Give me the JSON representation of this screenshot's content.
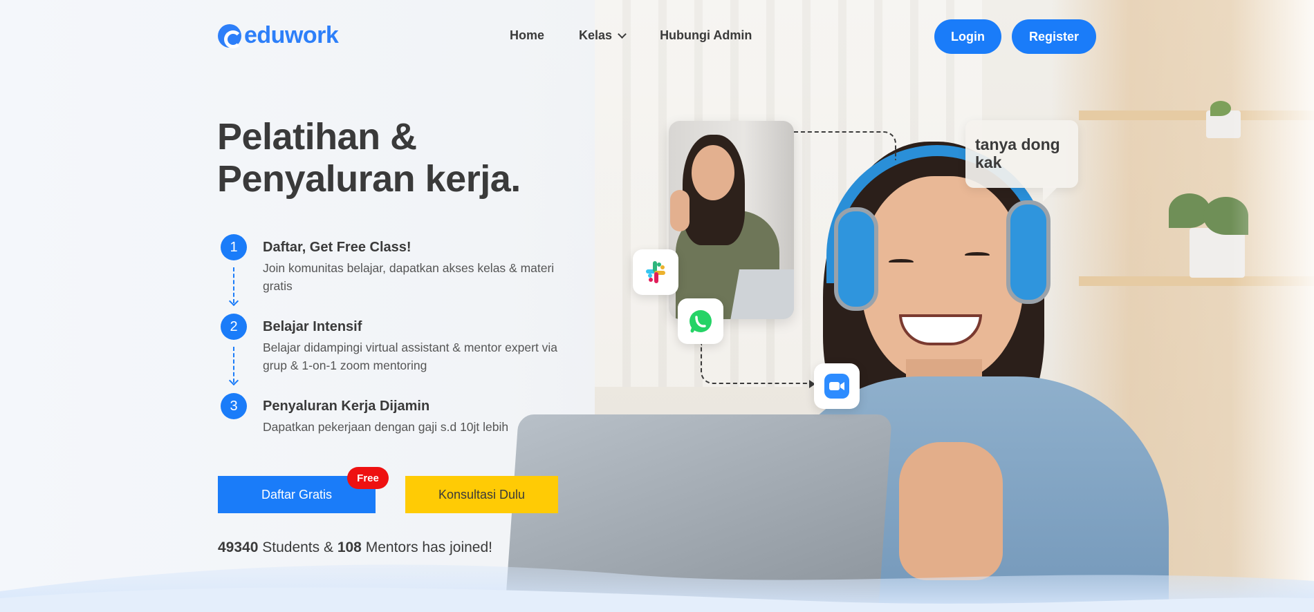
{
  "brand": {
    "name": "eduwork",
    "color": "#2d7ff9"
  },
  "nav": {
    "links": [
      "Home",
      "Kelas",
      "Hubungi Admin"
    ],
    "login_label": "Login",
    "register_label": "Register"
  },
  "hero": {
    "headline_line1": "Pelatihan &",
    "headline_line2": "Penyaluran kerja.",
    "steps": [
      {
        "number": "1",
        "title": "Daftar, Get Free Class!",
        "desc": "Join komunitas belajar, dapatkan akses kelas & materi gratis"
      },
      {
        "number": "2",
        "title": "Belajar Intensif",
        "desc": "Belajar didampingi virtual assistant & mentor expert via grup & 1-on-1 zoom mentoring"
      },
      {
        "number": "3",
        "title": "Penyaluran Kerja Dijamin",
        "desc": "Dapatkan pekerjaan dengan gaji s.d 10jt lebih"
      }
    ],
    "cta_primary": "Daftar Gratis",
    "free_badge": "Free",
    "cta_secondary": "Konsultasi Dulu",
    "stats": {
      "students": "49340",
      "students_text": "Students &",
      "mentors": "108",
      "mentors_text": "Mentors has joined!"
    }
  },
  "collage": {
    "bubble_text": "tanya dong kak",
    "icons": [
      "slack-icon",
      "whatsapp-icon",
      "zoom-icon"
    ]
  },
  "colors": {
    "primary": "#1a7cf9",
    "secondary": "#ffcb05",
    "badge": "#ee1111",
    "text": "#3a3a3a"
  }
}
